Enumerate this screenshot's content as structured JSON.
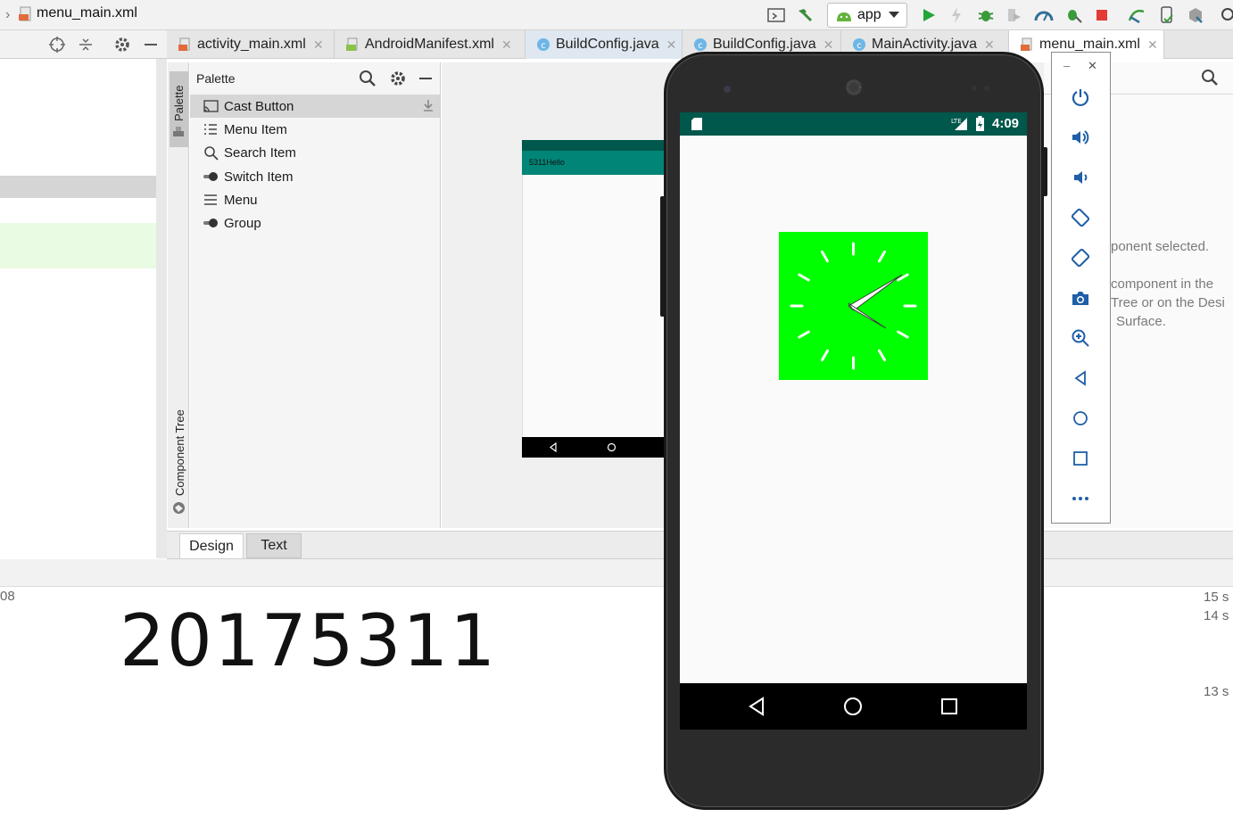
{
  "breadcrumb": {
    "current_file": "menu_main.xml"
  },
  "toolbar": {
    "run_config": "app"
  },
  "tabs": [
    {
      "label": "activity_main.xml",
      "type": "xml"
    },
    {
      "label": "AndroidManifest.xml",
      "type": "manifest"
    },
    {
      "label": "BuildConfig.java",
      "type": "class"
    },
    {
      "label": "BuildConfig.java",
      "type": "class"
    },
    {
      "label": "MainActivity.java",
      "type": "class"
    },
    {
      "label": "menu_main.xml",
      "type": "xml"
    }
  ],
  "side_tabs": {
    "palette": "Palette",
    "component_tree": "Component Tree"
  },
  "palette": {
    "title": "Palette",
    "items": [
      {
        "label": "Cast Button",
        "icon": "cast-icon"
      },
      {
        "label": "Menu Item",
        "icon": "list-icon"
      },
      {
        "label": "Search Item",
        "icon": "search-icon"
      },
      {
        "label": "Switch Item",
        "icon": "switch-icon"
      },
      {
        "label": "Menu",
        "icon": "menu-icon"
      },
      {
        "label": "Group",
        "icon": "switch-icon"
      }
    ]
  },
  "blueprint": {
    "app_title": "5311Hello"
  },
  "attributes": {
    "line1": "ponent selected.",
    "line2": "component in the",
    "line3": "Tree or on the Desi",
    "line4": "Surface."
  },
  "bottom_tabs": {
    "design": "Design",
    "text": "Text"
  },
  "console": {
    "left_fragment": "08",
    "big_text": "20175311",
    "times": [
      "15 s",
      "14 s",
      "13 s"
    ]
  },
  "emulator": {
    "status_time": "4:09",
    "clock_color": "#00ff00",
    "controls": [
      "minimize",
      "close"
    ]
  },
  "colors": {
    "status_bar": "#00574b",
    "app_bar": "#008577",
    "run_green": "#22a638",
    "stop_red": "#e53935"
  }
}
